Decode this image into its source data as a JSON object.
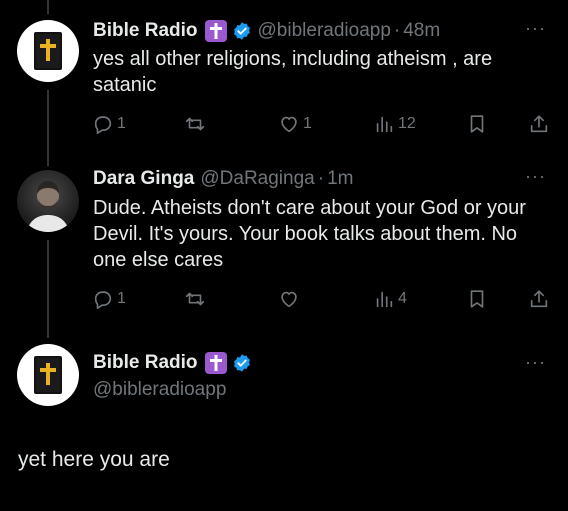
{
  "tweets": [
    {
      "name": "Bible Radio",
      "handle": "@bibleradioapp",
      "dot": "·",
      "time": "48m",
      "text": "yes all other religions, including atheism , are satanic",
      "reply_count": "1",
      "retweet_count": "",
      "like_count": "1",
      "view_count": "12"
    },
    {
      "name": "Dara Ginga",
      "handle": "@DaRaginga",
      "dot": "·",
      "time": "1m",
      "text": "Dude. Atheists don't care about your God or your Devil. It's yours. Your book talks about them. No one else cares",
      "reply_count": "1",
      "retweet_count": "",
      "like_count": "",
      "view_count": "4"
    }
  ],
  "main": {
    "name": "Bible Radio",
    "handle": "@bibleradioapp",
    "text": "yet here you are"
  },
  "more_label": "···",
  "colors": {
    "background": "#000000",
    "text": "#e7e9ea",
    "muted": "#71767b",
    "verified": "#1d9bf0",
    "cross_badge": "#9b59d0"
  }
}
